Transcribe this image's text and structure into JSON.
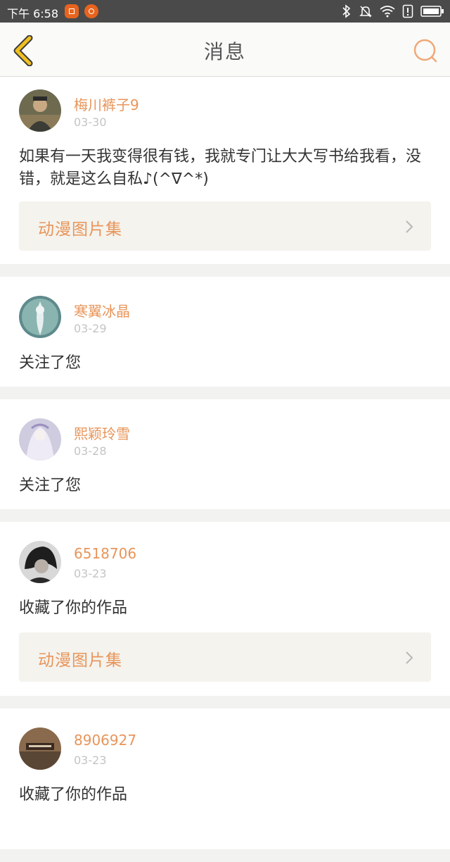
{
  "status_bar": {
    "time": "下午 6:58"
  },
  "header": {
    "title": "消息"
  },
  "colors": {
    "accent": "#e8955a",
    "back_icon": "#f0c020",
    "header_bg": "#fafaf8",
    "link_box_bg": "#f4f3ee"
  },
  "messages": [
    {
      "name": "梅川裤子9",
      "date": "03-30",
      "text": "如果有一天我变得很有钱，我就专门让大大写书给我看，没错，就是这么自私♪(^∇^*)",
      "link": "动漫图片集"
    },
    {
      "name": "寒翼冰晶",
      "date": "03-29",
      "text": "关注了您"
    },
    {
      "name": "熙颖玲雪",
      "date": "03-28",
      "text": "关注了您"
    },
    {
      "name": "6518706",
      "date": "03-23",
      "text": "收藏了你的作品",
      "link": "动漫图片集"
    },
    {
      "name": "8906927",
      "date": "03-23",
      "text": "收藏了你的作品"
    }
  ]
}
